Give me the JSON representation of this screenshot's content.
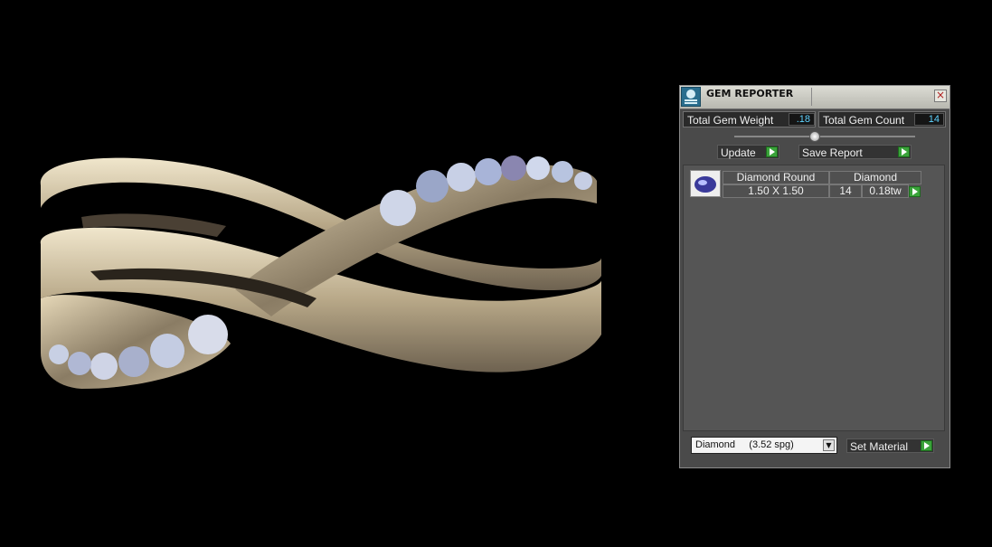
{
  "panel": {
    "title": "GEM REPORTER",
    "close_glyph": "×",
    "total_gem_weight": {
      "label": "Total Gem Weight",
      "value": ".18"
    },
    "total_gem_count": {
      "label": "Total Gem Count",
      "value": "14"
    },
    "update_label": "Update",
    "save_report_label": "Save Report",
    "gems": [
      {
        "name": "Diamond Round",
        "material": "Diamond",
        "size": "1.50 X 1.50",
        "count": "14",
        "weight": "0.18tw"
      }
    ],
    "material_select": {
      "value": "Diamond     (3.52 spg)"
    },
    "set_material_label": "Set Material"
  },
  "colors": {
    "viewport_background": "#000000",
    "panel_background": "#4a4a4a",
    "value_text": "#5fd3ff",
    "action_arrow": "#3aa33a",
    "ring_metal": "#d8c8a8"
  },
  "icons": [
    "gem-reporter-app-icon",
    "close-icon",
    "play-arrow-icon",
    "gem-thumbnail-icon",
    "dropdown-arrow-icon"
  ]
}
